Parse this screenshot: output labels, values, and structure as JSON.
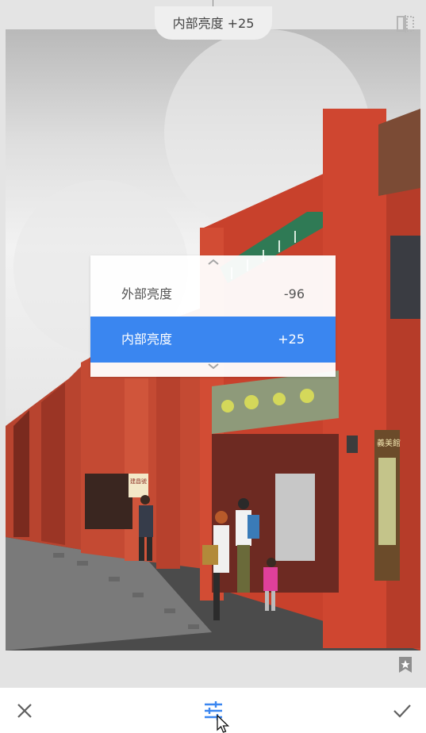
{
  "header": {
    "adjust_label": "内部亮度 +25",
    "compare_icon": "compare-icon"
  },
  "menu": {
    "up_icon": "chevron-up-icon",
    "down_icon": "chevron-down-icon",
    "items": [
      {
        "label": "外部亮度",
        "value": "-96",
        "selected": false
      },
      {
        "label": "内部亮度",
        "value": "+25",
        "selected": true
      }
    ]
  },
  "photo": {
    "shop_sign_1": "建昌號",
    "shop_sign_2": "義美館"
  },
  "bottom": {
    "star_icon": "star-bookmark-icon",
    "cancel_icon": "close-icon",
    "tune_icon": "tune-sliders-icon",
    "apply_icon": "check-icon"
  },
  "colors": {
    "accent": "#3a86f0",
    "brick": "#c8412c"
  }
}
